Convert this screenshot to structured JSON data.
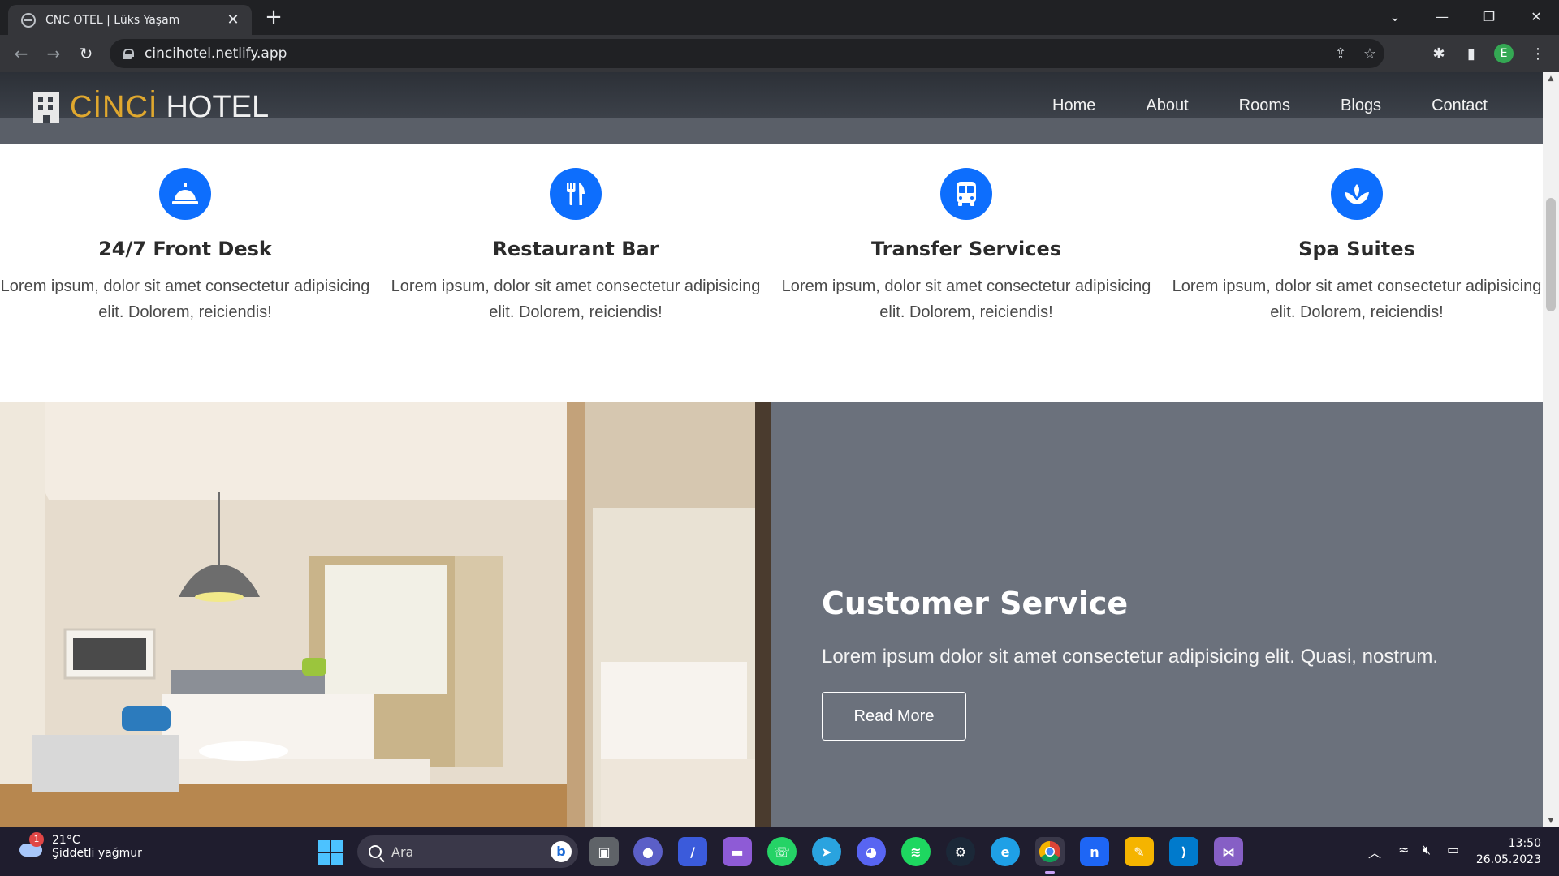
{
  "browser": {
    "tab_title": "CNC OTEL | Lüks Yaşam",
    "url": "cincihotel.netlify.app",
    "profile_initial": "E"
  },
  "site": {
    "brand_first": "CİNCİ",
    "brand_second": "HOTEL",
    "nav": [
      "Home",
      "About",
      "Rooms",
      "Blogs",
      "Contact"
    ]
  },
  "features": [
    {
      "icon": "concierge-bell-icon",
      "title": "24/7 Front Desk",
      "text": "Lorem ipsum, dolor sit amet consectetur adipisicing elit. Dolorem, reiciendis!"
    },
    {
      "icon": "utensils-icon",
      "title": "Restaurant Bar",
      "text": "Lorem ipsum, dolor sit amet consectetur adipisicing elit. Dolorem, reiciendis!"
    },
    {
      "icon": "bus-icon",
      "title": "Transfer Services",
      "text": "Lorem ipsum, dolor sit amet consectetur adipisicing elit. Dolorem, reiciendis!"
    },
    {
      "icon": "spa-icon",
      "title": "Spa Suites",
      "text": "Lorem ipsum, dolor sit amet consectetur adipisicing elit. Dolorem, reiciendis!"
    }
  ],
  "customer_service": {
    "title": "Customer Service",
    "text": "Lorem ipsum dolor sit amet consectetur adipisicing elit. Quasi, nostrum.",
    "button": "Read More"
  },
  "taskbar": {
    "weather_temp": "21°C",
    "weather_condition": "Şiddetli yağmur",
    "weather_badge": "1",
    "search_placeholder": "Ara",
    "time": "13:50",
    "date": "26.05.2023"
  },
  "colors": {
    "accent": "#0d6efd",
    "brand_gold": "#e0a82e",
    "cs_panel": "#6b717c"
  }
}
